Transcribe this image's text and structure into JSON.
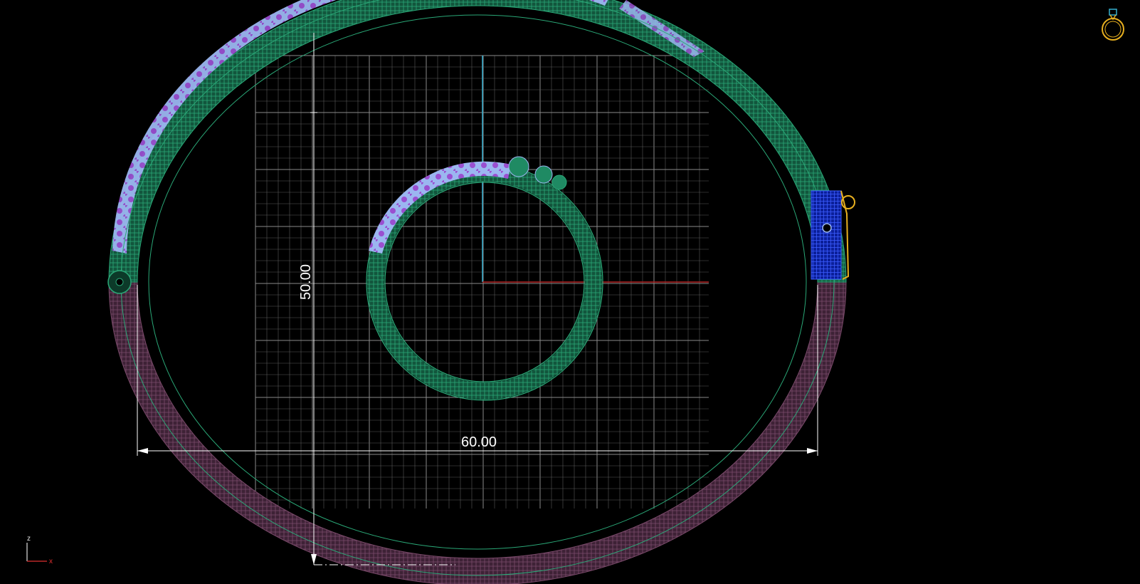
{
  "viewport": {
    "background": "#000000"
  },
  "dimensions": {
    "width_label": "60.00",
    "height_label": "50.00"
  },
  "axis_gizmo": {
    "z_label": "z",
    "x_label": "x",
    "z_color": "#e0e0e0",
    "x_color": "#e03030"
  },
  "colors": {
    "grid_line": "#5a5a5a",
    "grid_major": "#8a8a8a",
    "y_axis": "#35b0d0",
    "x_axis": "#b02020",
    "ring_green": "#1f8a63",
    "ring_mauve": "#6e3e5e",
    "gem_violet": "#9a4fd0",
    "gem_light": "#9bb6f0",
    "clasp_blue": "#1a3bd8",
    "clasp_gold": "#e8b020",
    "dimension_line": "#ffffff"
  },
  "icons": {
    "view_cube": "ring-view-icon"
  }
}
